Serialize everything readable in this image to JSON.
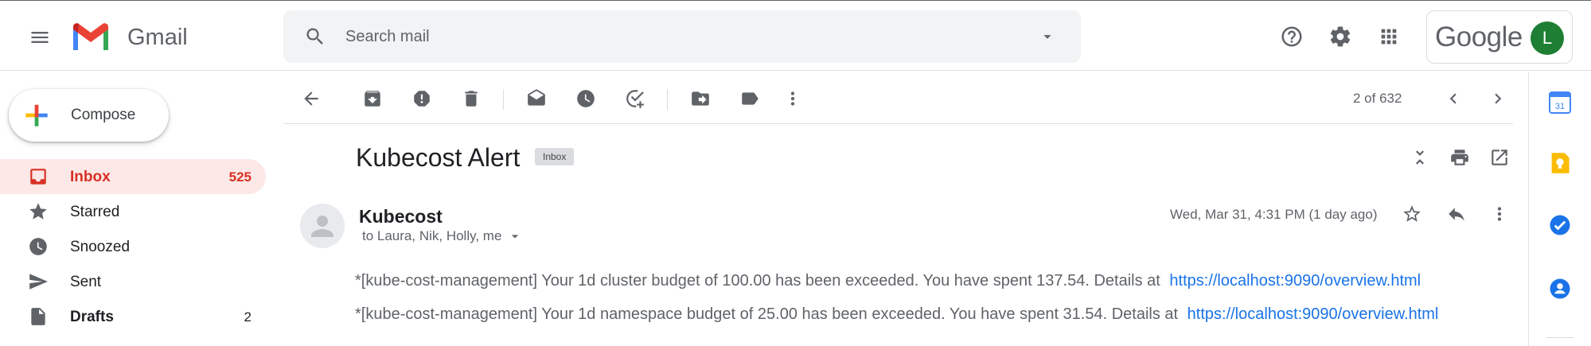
{
  "app": {
    "name": "Gmail"
  },
  "colors": {
    "accent_red": "#d93025",
    "link_blue": "#1a73e8",
    "avatar_green": "#1e7e34",
    "inbox_active_bg": "#fce8e6"
  },
  "search": {
    "placeholder": "Search mail"
  },
  "account": {
    "brand_word": "Google",
    "avatar_initial": "L"
  },
  "compose": {
    "label": "Compose"
  },
  "sidebar": {
    "items": [
      {
        "label": "Inbox",
        "count": "525",
        "icon": "inbox-icon",
        "active": true
      },
      {
        "label": "Starred",
        "count": "",
        "icon": "star-icon"
      },
      {
        "label": "Snoozed",
        "count": "",
        "icon": "clock-icon"
      },
      {
        "label": "Sent",
        "count": "",
        "icon": "send-icon"
      },
      {
        "label": "Drafts",
        "count": "2",
        "icon": "draft-icon"
      }
    ]
  },
  "toolbar": {
    "icons": [
      "back-arrow-icon",
      "archive-icon",
      "report-spam-icon",
      "delete-icon",
      "mark-unread-icon",
      "snooze-icon",
      "add-to-tasks-icon",
      "move-to-icon",
      "label-icon",
      "more-vert-icon"
    ],
    "pager": "2 of 632"
  },
  "message": {
    "subject": "Kubecost Alert",
    "label_chip": "Inbox",
    "sender": "Kubecost",
    "recipients": "to Laura, Nik, Holly, me",
    "date": "Wed, Mar 31, 4:31 PM (1 day ago)",
    "lines": [
      {
        "text": "*[kube-cost-management] Your 1d cluster budget of 100.00 has been exceeded. You have spent 137.54. Details at",
        "link": "https://localhost:9090/overview.html"
      },
      {
        "text": "*[kube-cost-management] Your 1d namespace budget of 25.00 has been exceeded. You have spent 31.54. Details at",
        "link": "https://localhost:9090/overview.html"
      }
    ]
  },
  "side_panel": {
    "calendar_day": "31",
    "icons": [
      "calendar-icon",
      "keep-icon",
      "tasks-icon",
      "contacts-icon"
    ]
  }
}
